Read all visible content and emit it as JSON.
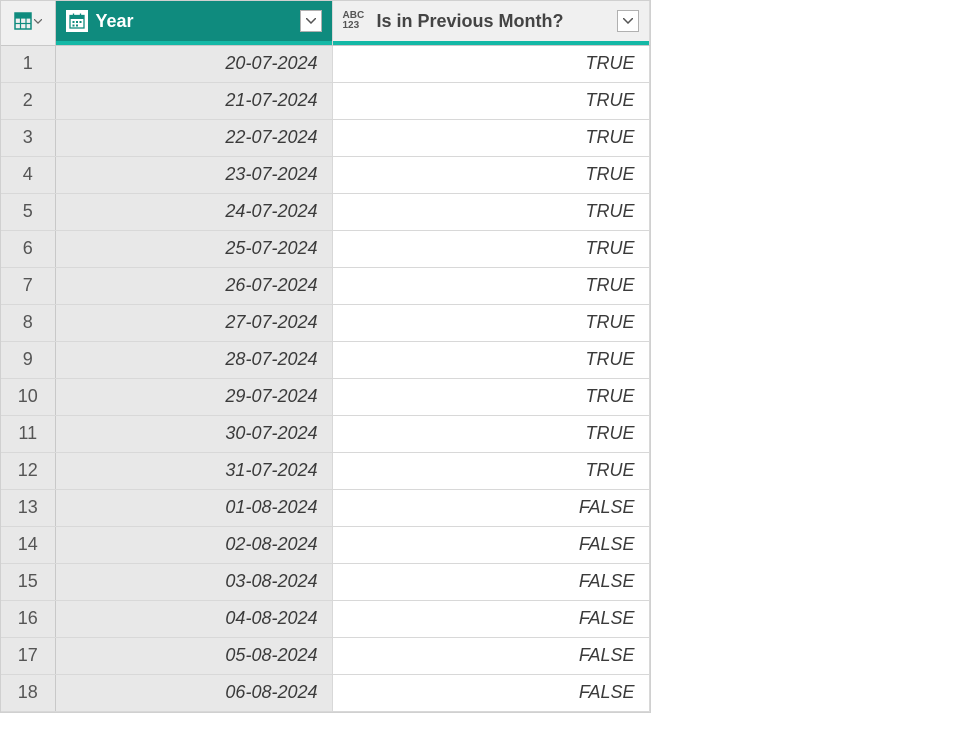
{
  "columns": {
    "year": {
      "label": "Year"
    },
    "prev": {
      "label": "Is in Previous Month?"
    },
    "abc": "ABC",
    "num": "123"
  },
  "rows": [
    {
      "n": "1",
      "year": "20-07-2024",
      "prev": "TRUE"
    },
    {
      "n": "2",
      "year": "21-07-2024",
      "prev": "TRUE"
    },
    {
      "n": "3",
      "year": "22-07-2024",
      "prev": "TRUE"
    },
    {
      "n": "4",
      "year": "23-07-2024",
      "prev": "TRUE"
    },
    {
      "n": "5",
      "year": "24-07-2024",
      "prev": "TRUE"
    },
    {
      "n": "6",
      "year": "25-07-2024",
      "prev": "TRUE"
    },
    {
      "n": "7",
      "year": "26-07-2024",
      "prev": "TRUE"
    },
    {
      "n": "8",
      "year": "27-07-2024",
      "prev": "TRUE"
    },
    {
      "n": "9",
      "year": "28-07-2024",
      "prev": "TRUE"
    },
    {
      "n": "10",
      "year": "29-07-2024",
      "prev": "TRUE"
    },
    {
      "n": "11",
      "year": "30-07-2024",
      "prev": "TRUE"
    },
    {
      "n": "12",
      "year": "31-07-2024",
      "prev": "TRUE"
    },
    {
      "n": "13",
      "year": "01-08-2024",
      "prev": "FALSE"
    },
    {
      "n": "14",
      "year": "02-08-2024",
      "prev": "FALSE"
    },
    {
      "n": "15",
      "year": "03-08-2024",
      "prev": "FALSE"
    },
    {
      "n": "16",
      "year": "04-08-2024",
      "prev": "FALSE"
    },
    {
      "n": "17",
      "year": "05-08-2024",
      "prev": "FALSE"
    },
    {
      "n": "18",
      "year": "06-08-2024",
      "prev": "FALSE"
    }
  ]
}
